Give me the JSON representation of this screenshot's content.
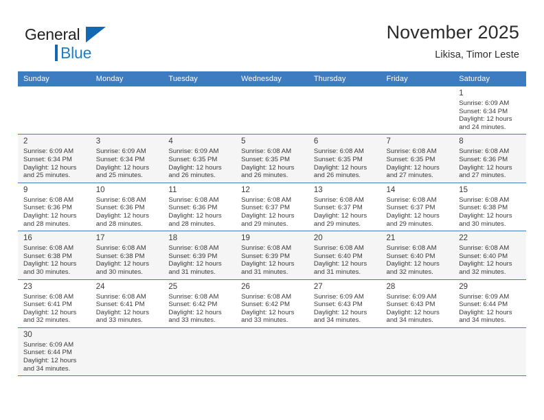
{
  "brand": {
    "name_top": "General",
    "name_bottom": "Blue",
    "triangle_icon": "triangle-icon",
    "accent_color": "#1368b3",
    "text_color": "#1f7dc4"
  },
  "header": {
    "title": "November 2025",
    "subtitle": "Likisa, Timor Leste"
  },
  "theme": {
    "header_row_bg": "#3d7cc0",
    "row_alt_bg": "#f5f5f5",
    "grid_line": "#3d7cc0"
  },
  "calendar": {
    "weekday_headers": [
      "Sunday",
      "Monday",
      "Tuesday",
      "Wednesday",
      "Thursday",
      "Friday",
      "Saturday"
    ],
    "weeks": [
      [
        {
          "day": "",
          "sunrise": "",
          "sunset": "",
          "daylight_line1": "",
          "daylight_line2": ""
        },
        {
          "day": "",
          "sunrise": "",
          "sunset": "",
          "daylight_line1": "",
          "daylight_line2": ""
        },
        {
          "day": "",
          "sunrise": "",
          "sunset": "",
          "daylight_line1": "",
          "daylight_line2": ""
        },
        {
          "day": "",
          "sunrise": "",
          "sunset": "",
          "daylight_line1": "",
          "daylight_line2": ""
        },
        {
          "day": "",
          "sunrise": "",
          "sunset": "",
          "daylight_line1": "",
          "daylight_line2": ""
        },
        {
          "day": "",
          "sunrise": "",
          "sunset": "",
          "daylight_line1": "",
          "daylight_line2": ""
        },
        {
          "day": "1",
          "sunrise": "Sunrise: 6:09 AM",
          "sunset": "Sunset: 6:34 PM",
          "daylight_line1": "Daylight: 12 hours",
          "daylight_line2": "and 24 minutes."
        }
      ],
      [
        {
          "day": "2",
          "sunrise": "Sunrise: 6:09 AM",
          "sunset": "Sunset: 6:34 PM",
          "daylight_line1": "Daylight: 12 hours",
          "daylight_line2": "and 25 minutes."
        },
        {
          "day": "3",
          "sunrise": "Sunrise: 6:09 AM",
          "sunset": "Sunset: 6:34 PM",
          "daylight_line1": "Daylight: 12 hours",
          "daylight_line2": "and 25 minutes."
        },
        {
          "day": "4",
          "sunrise": "Sunrise: 6:09 AM",
          "sunset": "Sunset: 6:35 PM",
          "daylight_line1": "Daylight: 12 hours",
          "daylight_line2": "and 26 minutes."
        },
        {
          "day": "5",
          "sunrise": "Sunrise: 6:08 AM",
          "sunset": "Sunset: 6:35 PM",
          "daylight_line1": "Daylight: 12 hours",
          "daylight_line2": "and 26 minutes."
        },
        {
          "day": "6",
          "sunrise": "Sunrise: 6:08 AM",
          "sunset": "Sunset: 6:35 PM",
          "daylight_line1": "Daylight: 12 hours",
          "daylight_line2": "and 26 minutes."
        },
        {
          "day": "7",
          "sunrise": "Sunrise: 6:08 AM",
          "sunset": "Sunset: 6:35 PM",
          "daylight_line1": "Daylight: 12 hours",
          "daylight_line2": "and 27 minutes."
        },
        {
          "day": "8",
          "sunrise": "Sunrise: 6:08 AM",
          "sunset": "Sunset: 6:36 PM",
          "daylight_line1": "Daylight: 12 hours",
          "daylight_line2": "and 27 minutes."
        }
      ],
      [
        {
          "day": "9",
          "sunrise": "Sunrise: 6:08 AM",
          "sunset": "Sunset: 6:36 PM",
          "daylight_line1": "Daylight: 12 hours",
          "daylight_line2": "and 28 minutes."
        },
        {
          "day": "10",
          "sunrise": "Sunrise: 6:08 AM",
          "sunset": "Sunset: 6:36 PM",
          "daylight_line1": "Daylight: 12 hours",
          "daylight_line2": "and 28 minutes."
        },
        {
          "day": "11",
          "sunrise": "Sunrise: 6:08 AM",
          "sunset": "Sunset: 6:36 PM",
          "daylight_line1": "Daylight: 12 hours",
          "daylight_line2": "and 28 minutes."
        },
        {
          "day": "12",
          "sunrise": "Sunrise: 6:08 AM",
          "sunset": "Sunset: 6:37 PM",
          "daylight_line1": "Daylight: 12 hours",
          "daylight_line2": "and 29 minutes."
        },
        {
          "day": "13",
          "sunrise": "Sunrise: 6:08 AM",
          "sunset": "Sunset: 6:37 PM",
          "daylight_line1": "Daylight: 12 hours",
          "daylight_line2": "and 29 minutes."
        },
        {
          "day": "14",
          "sunrise": "Sunrise: 6:08 AM",
          "sunset": "Sunset: 6:37 PM",
          "daylight_line1": "Daylight: 12 hours",
          "daylight_line2": "and 29 minutes."
        },
        {
          "day": "15",
          "sunrise": "Sunrise: 6:08 AM",
          "sunset": "Sunset: 6:38 PM",
          "daylight_line1": "Daylight: 12 hours",
          "daylight_line2": "and 30 minutes."
        }
      ],
      [
        {
          "day": "16",
          "sunrise": "Sunrise: 6:08 AM",
          "sunset": "Sunset: 6:38 PM",
          "daylight_line1": "Daylight: 12 hours",
          "daylight_line2": "and 30 minutes."
        },
        {
          "day": "17",
          "sunrise": "Sunrise: 6:08 AM",
          "sunset": "Sunset: 6:38 PM",
          "daylight_line1": "Daylight: 12 hours",
          "daylight_line2": "and 30 minutes."
        },
        {
          "day": "18",
          "sunrise": "Sunrise: 6:08 AM",
          "sunset": "Sunset: 6:39 PM",
          "daylight_line1": "Daylight: 12 hours",
          "daylight_line2": "and 31 minutes."
        },
        {
          "day": "19",
          "sunrise": "Sunrise: 6:08 AM",
          "sunset": "Sunset: 6:39 PM",
          "daylight_line1": "Daylight: 12 hours",
          "daylight_line2": "and 31 minutes."
        },
        {
          "day": "20",
          "sunrise": "Sunrise: 6:08 AM",
          "sunset": "Sunset: 6:40 PM",
          "daylight_line1": "Daylight: 12 hours",
          "daylight_line2": "and 31 minutes."
        },
        {
          "day": "21",
          "sunrise": "Sunrise: 6:08 AM",
          "sunset": "Sunset: 6:40 PM",
          "daylight_line1": "Daylight: 12 hours",
          "daylight_line2": "and 32 minutes."
        },
        {
          "day": "22",
          "sunrise": "Sunrise: 6:08 AM",
          "sunset": "Sunset: 6:40 PM",
          "daylight_line1": "Daylight: 12 hours",
          "daylight_line2": "and 32 minutes."
        }
      ],
      [
        {
          "day": "23",
          "sunrise": "Sunrise: 6:08 AM",
          "sunset": "Sunset: 6:41 PM",
          "daylight_line1": "Daylight: 12 hours",
          "daylight_line2": "and 32 minutes."
        },
        {
          "day": "24",
          "sunrise": "Sunrise: 6:08 AM",
          "sunset": "Sunset: 6:41 PM",
          "daylight_line1": "Daylight: 12 hours",
          "daylight_line2": "and 33 minutes."
        },
        {
          "day": "25",
          "sunrise": "Sunrise: 6:08 AM",
          "sunset": "Sunset: 6:42 PM",
          "daylight_line1": "Daylight: 12 hours",
          "daylight_line2": "and 33 minutes."
        },
        {
          "day": "26",
          "sunrise": "Sunrise: 6:08 AM",
          "sunset": "Sunset: 6:42 PM",
          "daylight_line1": "Daylight: 12 hours",
          "daylight_line2": "and 33 minutes."
        },
        {
          "day": "27",
          "sunrise": "Sunrise: 6:09 AM",
          "sunset": "Sunset: 6:43 PM",
          "daylight_line1": "Daylight: 12 hours",
          "daylight_line2": "and 34 minutes."
        },
        {
          "day": "28",
          "sunrise": "Sunrise: 6:09 AM",
          "sunset": "Sunset: 6:43 PM",
          "daylight_line1": "Daylight: 12 hours",
          "daylight_line2": "and 34 minutes."
        },
        {
          "day": "29",
          "sunrise": "Sunrise: 6:09 AM",
          "sunset": "Sunset: 6:44 PM",
          "daylight_line1": "Daylight: 12 hours",
          "daylight_line2": "and 34 minutes."
        }
      ],
      [
        {
          "day": "30",
          "sunrise": "Sunrise: 6:09 AM",
          "sunset": "Sunset: 6:44 PM",
          "daylight_line1": "Daylight: 12 hours",
          "daylight_line2": "and 34 minutes."
        },
        {
          "day": "",
          "sunrise": "",
          "sunset": "",
          "daylight_line1": "",
          "daylight_line2": ""
        },
        {
          "day": "",
          "sunrise": "",
          "sunset": "",
          "daylight_line1": "",
          "daylight_line2": ""
        },
        {
          "day": "",
          "sunrise": "",
          "sunset": "",
          "daylight_line1": "",
          "daylight_line2": ""
        },
        {
          "day": "",
          "sunrise": "",
          "sunset": "",
          "daylight_line1": "",
          "daylight_line2": ""
        },
        {
          "day": "",
          "sunrise": "",
          "sunset": "",
          "daylight_line1": "",
          "daylight_line2": ""
        },
        {
          "day": "",
          "sunrise": "",
          "sunset": "",
          "daylight_line1": "",
          "daylight_line2": ""
        }
      ]
    ]
  }
}
